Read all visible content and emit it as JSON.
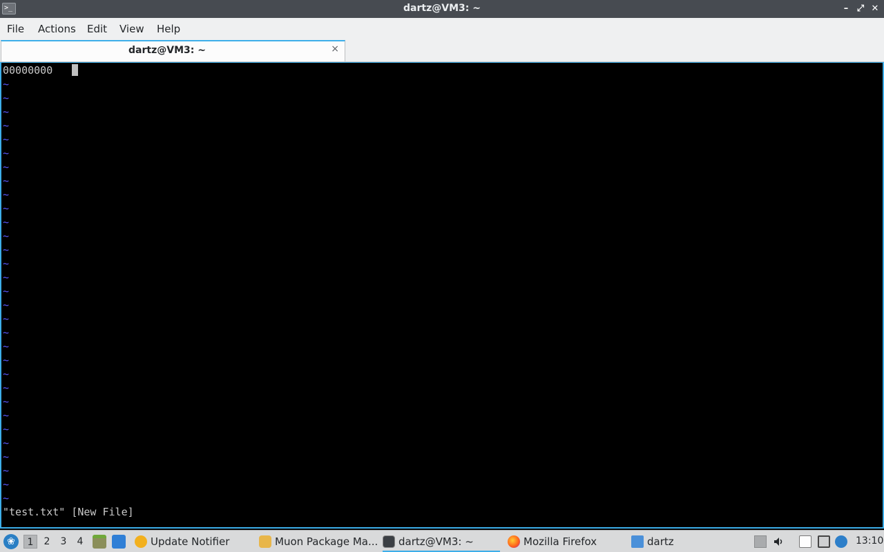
{
  "window": {
    "title": "dartz@VM3: ~",
    "app_icon": "terminal-icon"
  },
  "menu": [
    "File",
    "Actions",
    "Edit",
    "View",
    "Help"
  ],
  "tab": {
    "label": "dartz@VM3: ~",
    "close_glyph": "×"
  },
  "terminal": {
    "first_line": "00000000",
    "tilde_glyph": "~",
    "tilde_count": 31,
    "status_line": "\"test.txt\" [New File]"
  },
  "taskbar": {
    "workspaces": [
      "1",
      "2",
      "3",
      "4"
    ],
    "active_workspace": "1",
    "tasks": [
      {
        "label": "Update Notifier",
        "icon": "update-notifier-icon"
      },
      {
        "label": "Muon Package Ma...",
        "icon": "package-manager-icon"
      },
      {
        "label": "dartz@VM3: ~",
        "icon": "terminal-icon"
      },
      {
        "label": "Mozilla Firefox",
        "icon": "firefox-icon"
      },
      {
        "label": "dartz",
        "icon": "folder-icon"
      }
    ],
    "clock": "13:10"
  },
  "colors": {
    "accent": "#3daee9",
    "tilde": "#5a5aff",
    "titlebar": "#474b51"
  }
}
